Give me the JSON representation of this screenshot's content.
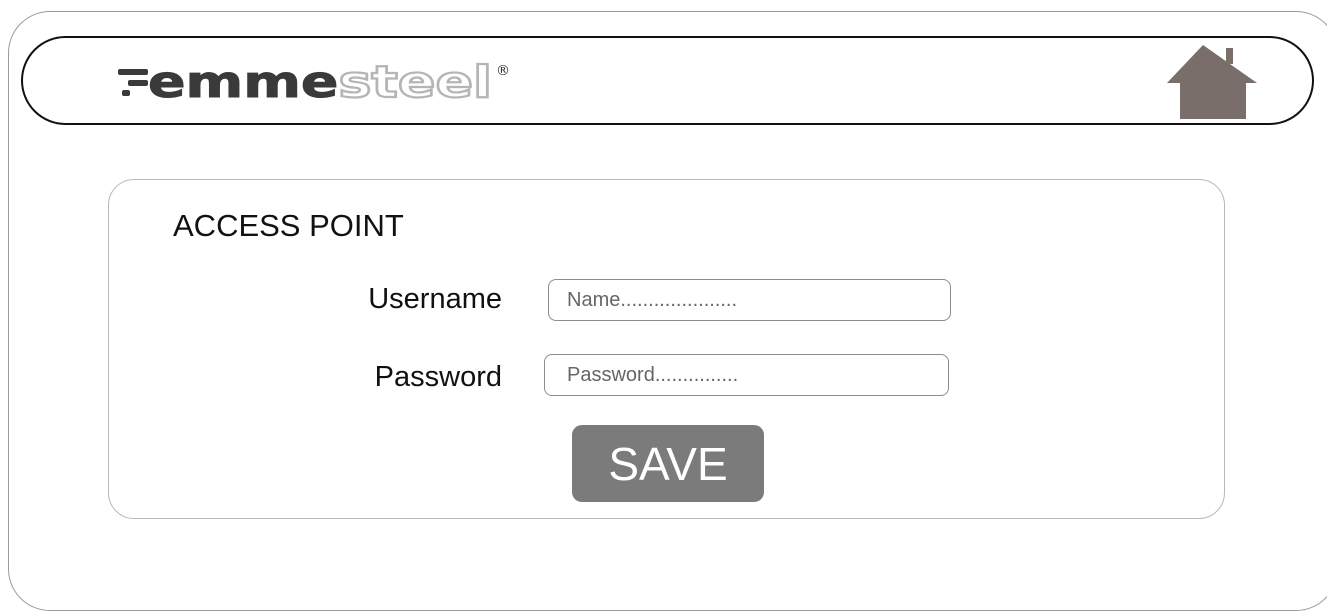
{
  "header": {
    "logo_text_bold": "emme",
    "logo_text_light": "steel",
    "logo_mark": "®",
    "home_icon": "house-icon"
  },
  "form": {
    "title": "ACCESS POINT",
    "username_label": "Username",
    "username_placeholder": "Name.....................",
    "password_label": "Password",
    "password_placeholder": "Password...............",
    "save_label": "SAVE"
  },
  "colors": {
    "logo_dark": "#3a3a3a",
    "logo_light": "#c8c8c8",
    "home_icon": "#7a6e6b",
    "save_button": "#7b7b7b"
  }
}
